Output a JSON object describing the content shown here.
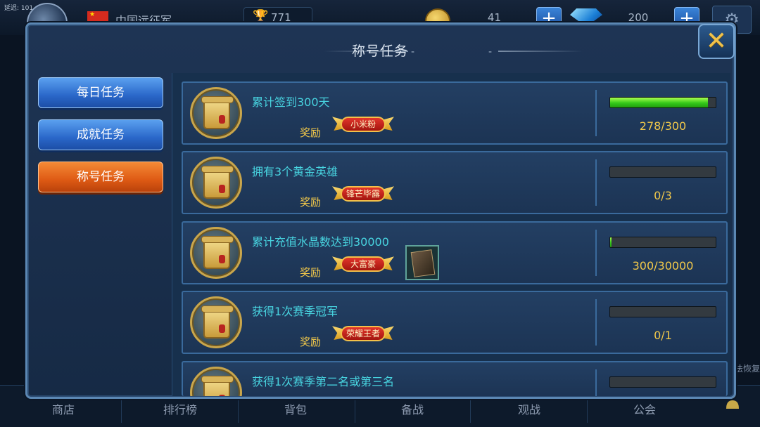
{
  "hud": {
    "latency": "延迟: 101",
    "player_name": "中国远征军",
    "trophies": "771",
    "gold": "41",
    "gems": "200",
    "add_icon": "plus-icon",
    "settings_icon": "gear-icon"
  },
  "dialog": {
    "title": "称号任务",
    "title_dash_left": "-",
    "title_dash_right": "-",
    "close_label": "✕"
  },
  "tabs": [
    {
      "label": "每日任务",
      "active": false
    },
    {
      "label": "成就任务",
      "active": false
    },
    {
      "label": "称号任务",
      "active": true
    }
  ],
  "reward_label": "奖励",
  "tasks": [
    {
      "name": "累计签到300天",
      "badge": "小米粉",
      "has_card": false,
      "progress_text": "278/300",
      "progress": 0.927
    },
    {
      "name": "拥有3个黄金英雄",
      "badge": "锋芒毕露",
      "has_card": false,
      "progress_text": "0/3",
      "progress": 0
    },
    {
      "name": "累计充值水晶数达到30000",
      "badge": "大富豪",
      "has_card": true,
      "progress_text": "300/30000",
      "progress": 0.01
    },
    {
      "name": "获得1次赛季冠军",
      "badge": "荣耀王者",
      "has_card": false,
      "progress_text": "0/1",
      "progress": 0
    },
    {
      "name": "获得1次赛季第二名或第三名",
      "badge": "",
      "has_card": false,
      "progress_text": "",
      "progress": 0
    }
  ],
  "bottom_menu": [
    "商店",
    "排行榜",
    "背包",
    "备战",
    "观战",
    "公会"
  ],
  "side_hint": "法恢复",
  "colors": {
    "accent_green": "#34c81a",
    "tab_orange": "#de5a14",
    "tab_blue": "#2a67c9",
    "gold_text": "#f1c84a",
    "cyan_text": "#48d4e0"
  }
}
